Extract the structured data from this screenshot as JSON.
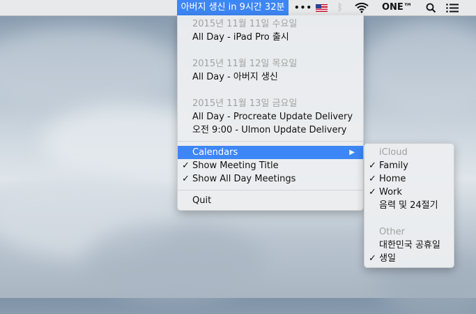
{
  "menubar": {
    "app_title": "아버지 생신 in 9시간 32분",
    "more_label": "•••",
    "bluetooth_glyph": "ᛒ",
    "text_item": "ONE™",
    "icons": [
      "flag-us-icon",
      "bluetooth-icon",
      "wifi-icon",
      "spotlight-search-icon",
      "notification-center-icon"
    ]
  },
  "menu": {
    "events": [
      {
        "date": "2015년 11월 11일 수요일",
        "items": [
          "All Day - iPad Pro 출시"
        ]
      },
      {
        "date": "2015년 11월 12일 목요일",
        "items": [
          "All Day - 아버지 생신"
        ]
      },
      {
        "date": "2015년 11월 13일 금요일",
        "items": [
          "All Day - Procreate Update Delivery",
          "오전 9:00 - Ulmon Update Delivery"
        ]
      }
    ],
    "calendars_label": "Calendars",
    "submenu_arrow": "▶",
    "check_glyph": "✓",
    "show_meeting_title": "Show Meeting Title",
    "show_all_day": "Show All Day Meetings",
    "quit": "Quit"
  },
  "submenu": {
    "icloud_header": "iCloud",
    "icloud_items": [
      {
        "label": "Family",
        "checked": true
      },
      {
        "label": "Home",
        "checked": true
      },
      {
        "label": "Work",
        "checked": true
      },
      {
        "label": "음력 및 24절기",
        "checked": false
      }
    ],
    "other_header": "Other",
    "other_items": [
      {
        "label": "대한민국 공휴일",
        "checked": false
      },
      {
        "label": "생일",
        "checked": true
      }
    ]
  },
  "colors": {
    "accent": "#3d86f5",
    "menu_bg": "#ebedf0",
    "disabled_text": "#a1a1a1"
  }
}
